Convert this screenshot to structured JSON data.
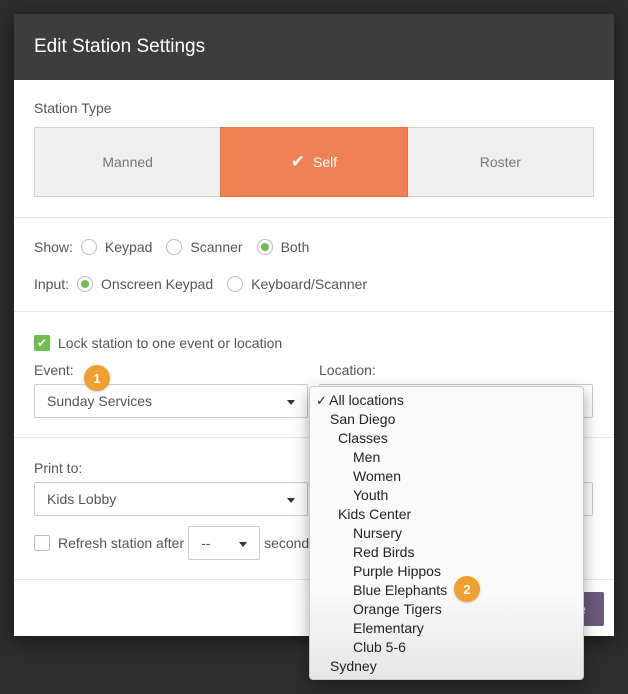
{
  "modal": {
    "title": "Edit Station Settings"
  },
  "station_type": {
    "label": "Station Type",
    "options": [
      {
        "label": "Manned",
        "active": false
      },
      {
        "label": "Self",
        "active": true
      },
      {
        "label": "Roster",
        "active": false
      }
    ]
  },
  "show": {
    "label": "Show:",
    "options": [
      {
        "label": "Keypad",
        "selected": false
      },
      {
        "label": "Scanner",
        "selected": false
      },
      {
        "label": "Both",
        "selected": true
      }
    ]
  },
  "input": {
    "label": "Input:",
    "options": [
      {
        "label": "Onscreen Keypad",
        "selected": true
      },
      {
        "label": "Keyboard/Scanner",
        "selected": false
      }
    ]
  },
  "lock": {
    "label": "Lock station to one event or location",
    "checked": true,
    "event_label": "Event:",
    "event_value": "Sunday Services",
    "location_label": "Location:",
    "badge_1": "1",
    "badge_2": "2"
  },
  "print": {
    "label": "Print to:",
    "value": "Kids Lobby"
  },
  "refresh": {
    "label": "Refresh station after",
    "value": "--",
    "suffix": "seconds",
    "checked": false
  },
  "footer": {
    "save_label": "e"
  },
  "location_dropdown": {
    "items": [
      {
        "label": "All locations",
        "level": 0,
        "selected": true
      },
      {
        "label": "San Diego",
        "level": 1
      },
      {
        "label": "Classes",
        "level": 2
      },
      {
        "label": "Men",
        "level": 3
      },
      {
        "label": "Women",
        "level": 3
      },
      {
        "label": "Youth",
        "level": 3
      },
      {
        "label": "Kids Center",
        "level": 2
      },
      {
        "label": "Nursery",
        "level": 3
      },
      {
        "label": "Red Birds",
        "level": 3
      },
      {
        "label": "Purple Hippos",
        "level": 3
      },
      {
        "label": "Blue Elephants",
        "level": 3
      },
      {
        "label": "Orange Tigers",
        "level": 3
      },
      {
        "label": "Elementary",
        "level": 3
      },
      {
        "label": "Club 5-6",
        "level": 3
      },
      {
        "label": "Sydney",
        "level": 1
      }
    ]
  },
  "colors": {
    "accent": "#ef8254",
    "check_green": "#6fbe4e",
    "badge": "#f0a030",
    "header": "#3d3d3d"
  }
}
